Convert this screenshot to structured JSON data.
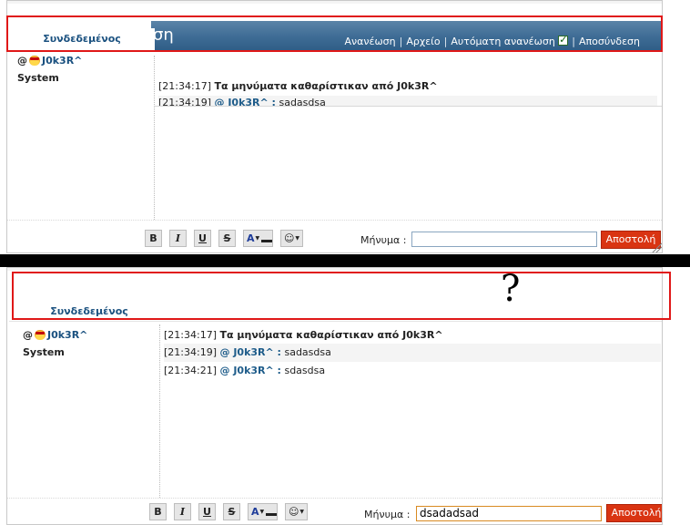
{
  "top": {
    "online_tab": "Συνδεδεμένος",
    "banner_fragment": "ση",
    "links": {
      "refresh": "Ανανέωση",
      "archive": "Αρχείο",
      "auto_refresh": "Αυτόματη ανανέωση",
      "logout": "Αποσύνδεση"
    },
    "users": [
      {
        "prefix": "@",
        "name": "J0k3R^"
      },
      {
        "prefix": "",
        "name": "System"
      }
    ],
    "messages": [
      {
        "time": "[21:34:17]",
        "nick": "",
        "text": "Τα μηνύματα καθαρίστικαν από J0k3R^"
      },
      {
        "time": "[21:34:19]",
        "nick": "@ J0k3R^ :",
        "text": "sadasdsa"
      }
    ],
    "toolbar": {
      "bold": "B",
      "italic": "I",
      "underline": "U",
      "strike": "S",
      "color": "A"
    },
    "message_label": "Μήνυμα :",
    "message_value": "",
    "send": "Αποστολή"
  },
  "bottom": {
    "online_tab": "Συνδεδεμένος",
    "users": [
      {
        "prefix": "@",
        "name": "J0k3R^"
      },
      {
        "prefix": "",
        "name": "System"
      }
    ],
    "messages": [
      {
        "time": "[21:34:17]",
        "nick": "",
        "text": "Τα μηνύματα καθαρίστικαν από J0k3R^"
      },
      {
        "time": "[21:34:19]",
        "nick": "@ J0k3R^ :",
        "text": "sadasdsa"
      },
      {
        "time": "[21:34:21]",
        "nick": "@ J0k3R^ :",
        "text": "sdasdsa"
      }
    ],
    "toolbar": {
      "bold": "B",
      "italic": "I",
      "underline": "U",
      "strike": "S",
      "color": "A"
    },
    "message_label": "Μήνυμα :",
    "message_value": "dsadadsad",
    "send": "Αποστολή"
  },
  "annotation": {
    "question": "?"
  },
  "colors": {
    "banner": "#3d6b94",
    "send": "#d93412",
    "highlight": "#e01818",
    "nick": "#1e5c8a"
  }
}
